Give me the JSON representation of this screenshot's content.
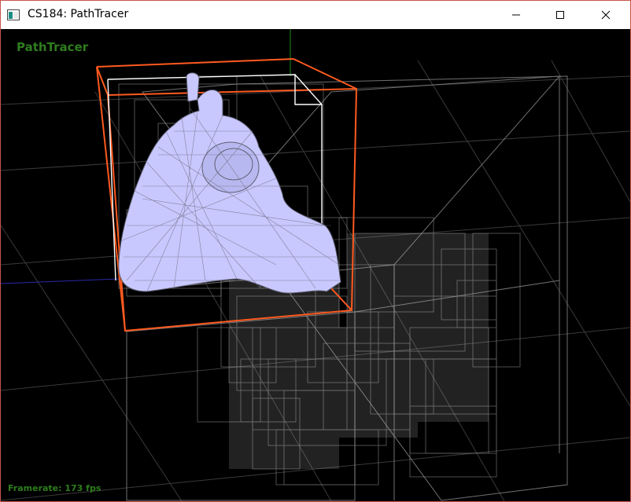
{
  "window": {
    "title": "CS184: PathTracer",
    "icon": "app-window-icon",
    "controls": [
      "minimize-icon",
      "maximize-icon",
      "close-icon"
    ]
  },
  "viewport": {
    "overlay_title": "PathTracer",
    "framerate_label": "Framerate: 173 fps"
  },
  "colors": {
    "overlay_text": "#2e7d1e",
    "selected_bbox": "#ff5a1f",
    "child_bbox": "#ffffff",
    "bvh_boxes": "#9a9a9a",
    "mesh_fill": "#c8c8ff",
    "mesh_wire": "#6a6a7a",
    "axis_green": "#1e8a1e",
    "axis_blue": "#2a2aa8"
  }
}
